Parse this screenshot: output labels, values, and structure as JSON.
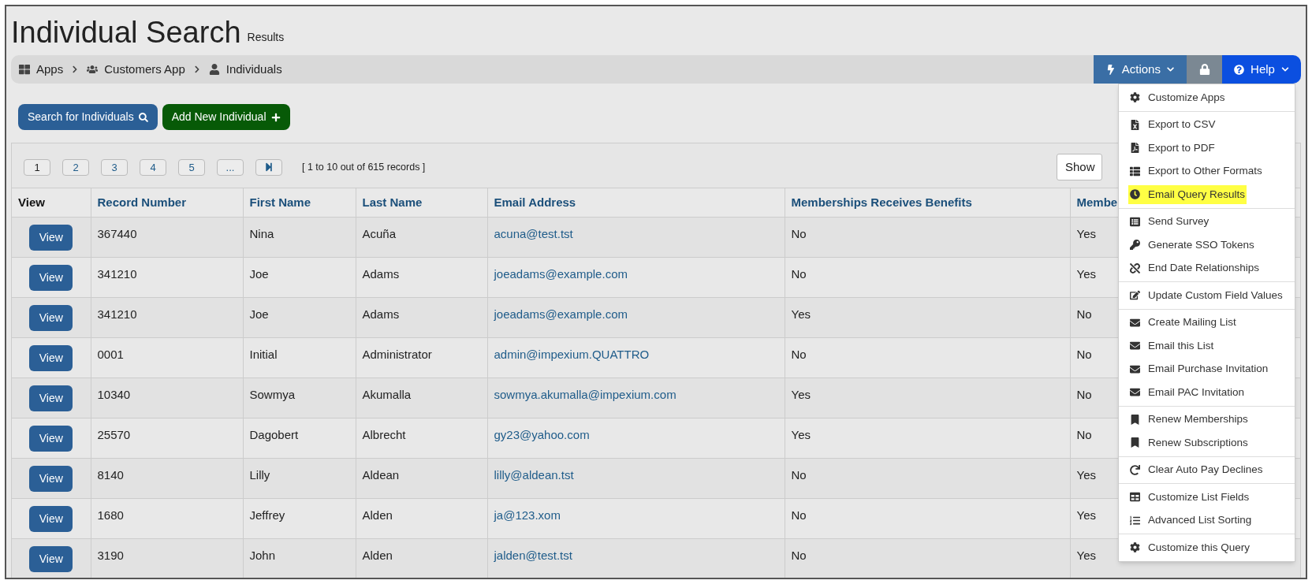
{
  "page": {
    "title": "Individual Search",
    "subtitle": "Results"
  },
  "breadcrumb": [
    "Apps",
    "Customers App",
    "Individuals"
  ],
  "toolbar": {
    "actions": "Actions",
    "help": "Help"
  },
  "buttons": {
    "search": "Search for Individuals",
    "add": "Add New Individual"
  },
  "pagination": {
    "pages": [
      {
        "label": "1",
        "selected": true
      },
      {
        "label": "2",
        "selected": false
      },
      {
        "label": "3",
        "selected": false
      },
      {
        "label": "4",
        "selected": false
      },
      {
        "label": "5",
        "selected": false
      },
      {
        "label": "...",
        "selected": false
      }
    ],
    "summary": "[ 1 to 10 out of 615 records ]",
    "show": "Show"
  },
  "table": {
    "columns": [
      "View",
      "Record Number",
      "First Name",
      "Last Name",
      "Email Address",
      "Memberships Receives Benefits",
      "Membe"
    ],
    "rows": [
      {
        "view": "View",
        "record": "367440",
        "first": "Nina",
        "last": "Acuña",
        "email": "acuna@test.tst",
        "benefits": "No",
        "column_7": "Yes"
      },
      {
        "view": "View",
        "record": "341210",
        "first": "Joe",
        "last": "Adams",
        "email": "joeadams@example.com",
        "benefits": "No",
        "column_7": "Yes"
      },
      {
        "view": "View",
        "record": "341210",
        "first": "Joe",
        "last": "Adams",
        "email": "joeadams@example.com",
        "benefits": "Yes",
        "column_7": "No"
      },
      {
        "view": "View",
        "record": "0001",
        "first": "Initial",
        "last": "Administrator",
        "email": "admin@impexium.QUATTRO",
        "benefits": "No",
        "column_7": "No"
      },
      {
        "view": "View",
        "record": "10340",
        "first": "Sowmya",
        "last": "Akumalla",
        "email": "sowmya.akumalla@impexium.com",
        "benefits": "Yes",
        "column_7": "No"
      },
      {
        "view": "View",
        "record": "25570",
        "first": "Dagobert",
        "last": "Albrecht",
        "email": "gy23@yahoo.com",
        "benefits": "Yes",
        "column_7": "No"
      },
      {
        "view": "View",
        "record": "8140",
        "first": "Lilly",
        "last": "Aldean",
        "email": "lilly@aldean.tst",
        "benefits": "No",
        "column_7": "Yes"
      },
      {
        "view": "View",
        "record": "1680",
        "first": "Jeffrey",
        "last": "Alden",
        "email": "ja@123.xom",
        "benefits": "No",
        "column_7": "Yes"
      },
      {
        "view": "View",
        "record": "3190",
        "first": "John",
        "last": "Alden",
        "email": "jalden@test.tst",
        "benefits": "No",
        "column_7": "Yes"
      }
    ]
  },
  "actions_menu": [
    [
      {
        "label": "Customize Apps",
        "highlighted": false
      }
    ],
    [
      {
        "label": "Export to CSV",
        "highlighted": false
      },
      {
        "label": "Export to PDF",
        "highlighted": false
      },
      {
        "label": "Export to Other Formats",
        "highlighted": false
      },
      {
        "label": "Email Query Results",
        "highlighted": true
      }
    ],
    [
      {
        "label": "Send Survey",
        "highlighted": false
      },
      {
        "label": "Generate SSO Tokens",
        "highlighted": false
      },
      {
        "label": "End Date Relationships",
        "highlighted": false
      }
    ],
    [
      {
        "label": "Update Custom Field Values",
        "highlighted": false
      }
    ],
    [
      {
        "label": "Create Mailing List",
        "highlighted": false
      },
      {
        "label": "Email this List",
        "highlighted": false
      },
      {
        "label": "Email Purchase Invitation",
        "highlighted": false
      },
      {
        "label": "Email PAC Invitation",
        "highlighted": false
      }
    ],
    [
      {
        "label": "Renew Memberships",
        "highlighted": false
      },
      {
        "label": "Renew Subscriptions",
        "highlighted": false
      }
    ],
    [
      {
        "label": "Clear Auto Pay Declines",
        "highlighted": false
      }
    ],
    [
      {
        "label": "Customize List Fields",
        "highlighted": false
      },
      {
        "label": "Advanced List Sorting",
        "highlighted": false
      }
    ],
    [
      {
        "label": "Customize this Query",
        "highlighted": false
      }
    ]
  ]
}
